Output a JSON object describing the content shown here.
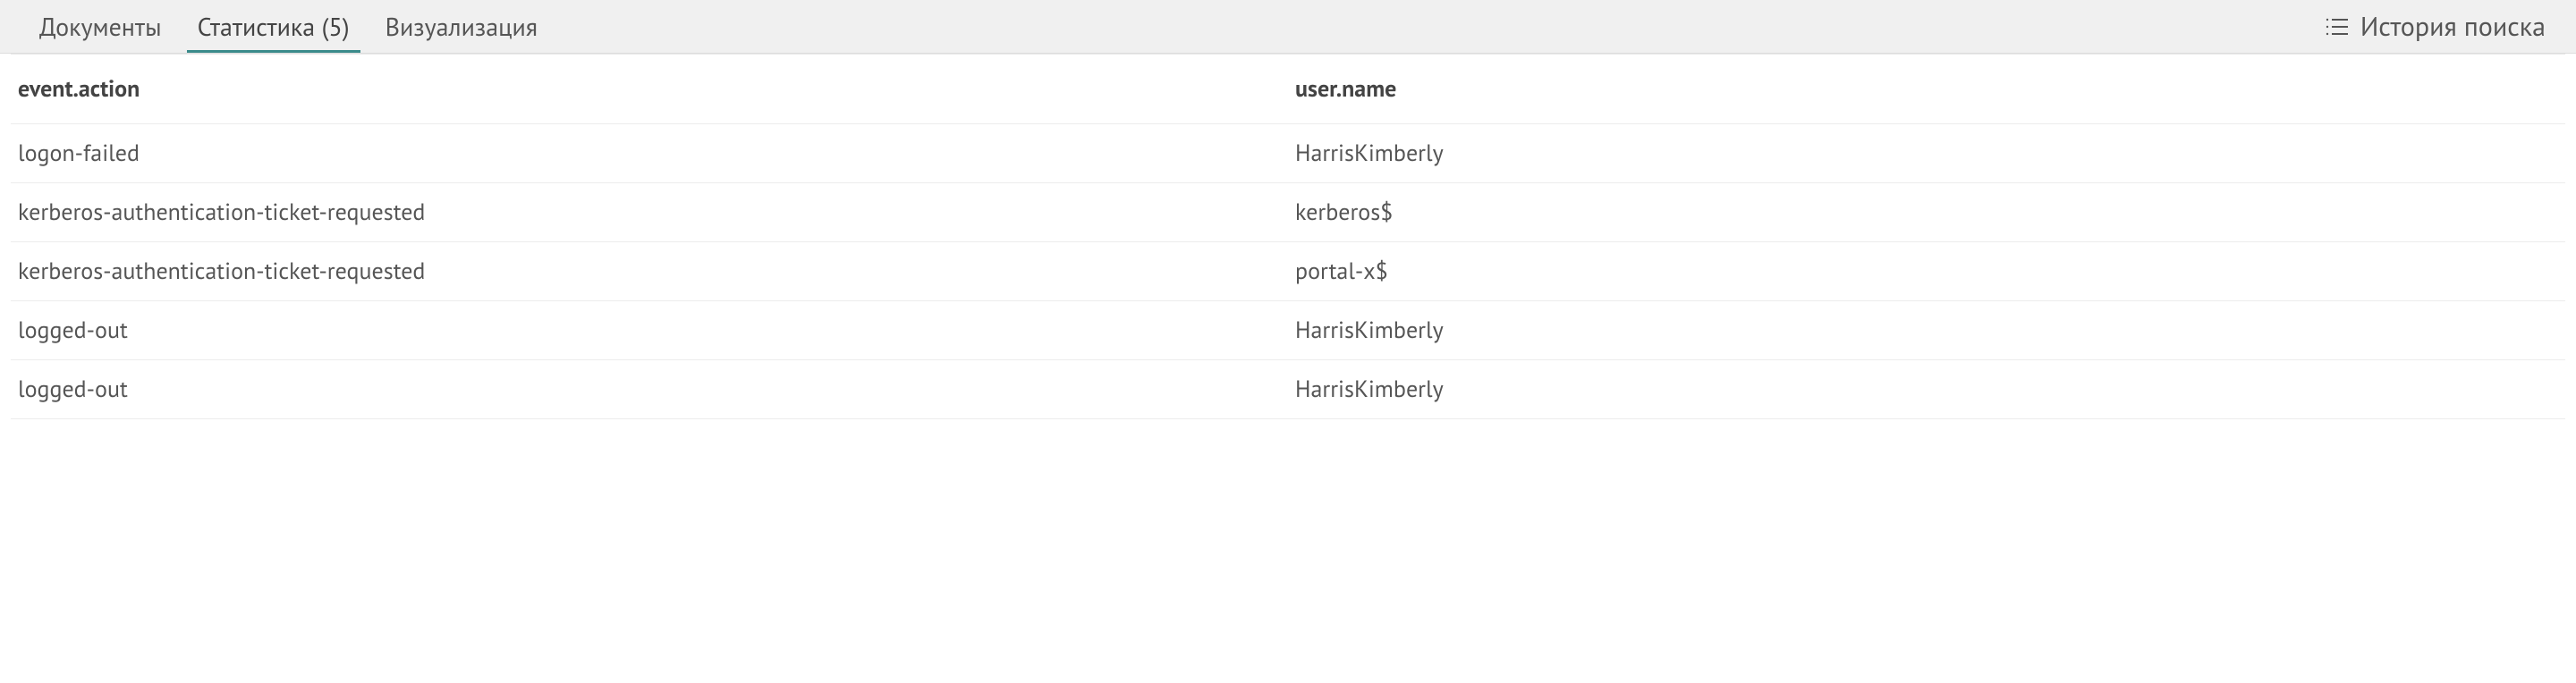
{
  "tabs": {
    "documents": "Документы",
    "statistics": "Статистика (5)",
    "visualization": "Визуализация"
  },
  "history_label": "История поиска",
  "table": {
    "headers": {
      "event_action": "event.action",
      "user_name": "user.name"
    },
    "rows": [
      {
        "event_action": "logon-failed",
        "user_name": "HarrisKimberly"
      },
      {
        "event_action": "kerberos-authentication-ticket-requested",
        "user_name": "kerberos$"
      },
      {
        "event_action": "kerberos-authentication-ticket-requested",
        "user_name": "portal-x$"
      },
      {
        "event_action": "logged-out",
        "user_name": "HarrisKimberly"
      },
      {
        "event_action": "logged-out",
        "user_name": "HarrisKimberly"
      }
    ]
  }
}
